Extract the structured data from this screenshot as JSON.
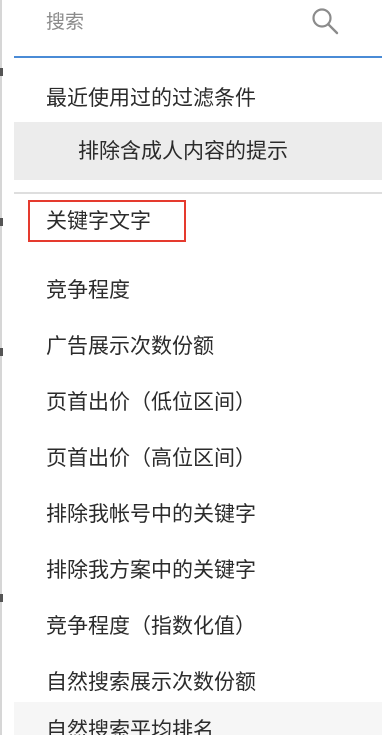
{
  "search": {
    "placeholder": "搜索",
    "icon": "search-icon"
  },
  "menu": {
    "recent_filters_label": "最近使用过的过滤条件",
    "highlighted_item": "排除含成人内容的提示",
    "items": [
      {
        "label": "关键字文字",
        "selected": true
      },
      {
        "label": "竞争程度"
      },
      {
        "label": "广告展示次数份额"
      },
      {
        "label": "页首出价（低位区间）"
      },
      {
        "label": "页首出价（高位区间）"
      },
      {
        "label": "排除我帐号中的关键字"
      },
      {
        "label": "排除我方案中的关键字"
      },
      {
        "label": "竞争程度（指数化值）"
      },
      {
        "label": "自然搜索展示次数份额"
      },
      {
        "label": "自然搜索平均排名"
      }
    ]
  },
  "colors": {
    "accent": "#4a8bd6",
    "selection_border": "#e53a2e",
    "highlight_bg": "#ececec"
  }
}
